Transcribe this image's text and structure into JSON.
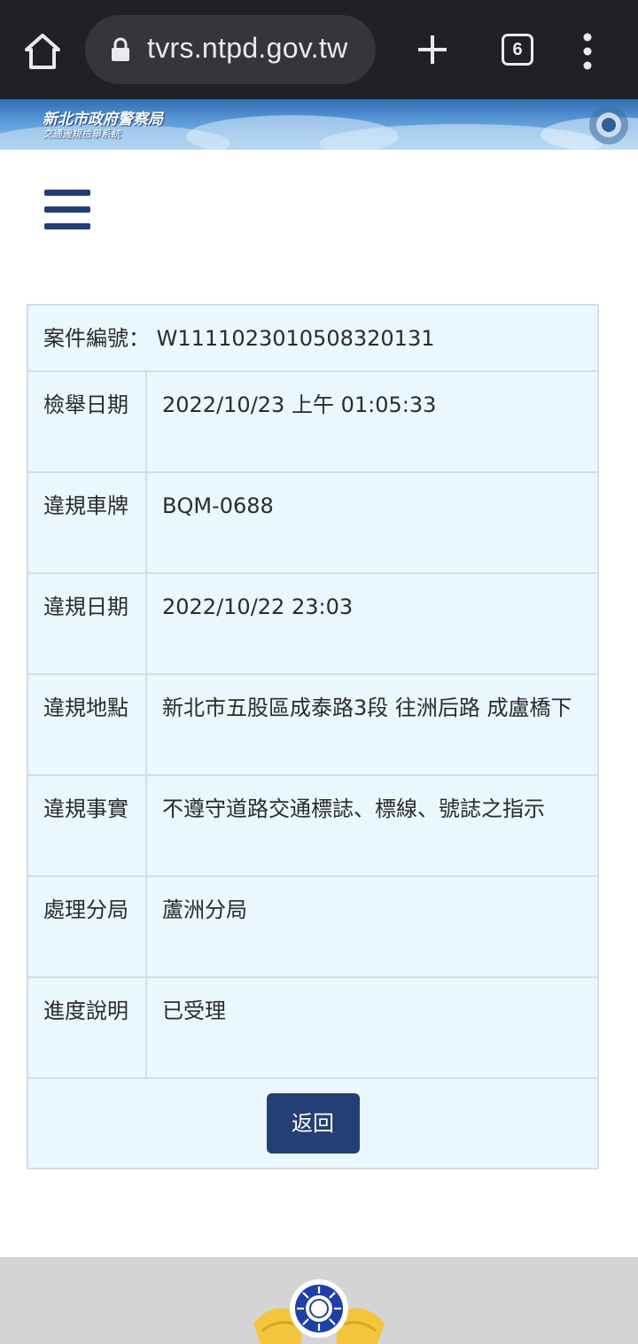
{
  "browser": {
    "url": "tvrs.ntpd.gov.tw",
    "tab_count": "6",
    "icons": [
      "home-icon",
      "lock-icon",
      "plus-icon",
      "tab-switcher-icon",
      "more-vert-icon"
    ]
  },
  "banner": {
    "title": "新北市政府警察局",
    "subtitle": "交通違規檢舉系統"
  },
  "case": {
    "header": "案件編號： W1111023010508320131",
    "rows": [
      {
        "label": "檢舉日期",
        "value": "2022/10/23 上午 01:05:33"
      },
      {
        "label": "違規車牌",
        "value": "BQM-0688"
      },
      {
        "label": "違規日期",
        "value": "2022/10/22 23:03"
      },
      {
        "label": "違規地點",
        "value": "新北市五股區成泰路3段 往洲后路 成盧橋下"
      },
      {
        "label": "違規事實",
        "value": "不遵守道路交通標誌、標線、號誌之指示"
      },
      {
        "label": "處理分局",
        "value": "蘆洲分局"
      },
      {
        "label": "進度說明",
        "value": "已受理"
      }
    ],
    "return_label": "返回"
  },
  "colors": {
    "chrome": "#202124",
    "url_pill": "#35363a",
    "primary": "#233f73",
    "table_bg": "#eaf7fc",
    "table_border": "#d4dede",
    "footer": "#d4d4d4"
  }
}
